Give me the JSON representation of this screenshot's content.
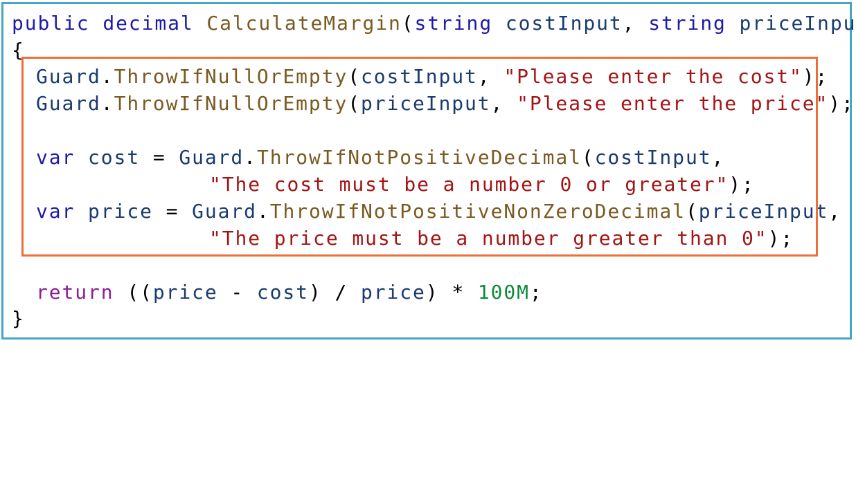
{
  "code": {
    "l1": {
      "kw1": "public",
      "kw2": "decimal",
      "method": "CalculateMargin",
      "p1": "(",
      "kw3": "string",
      "id1": "costInput",
      "p2": ",",
      "kw4": "string",
      "id2": "priceInput",
      "p3": ")"
    },
    "l2": {
      "brace": "{"
    },
    "l3": {
      "cls": "Guard",
      "dot": ".",
      "method": "ThrowIfNullOrEmpty",
      "p1": "(",
      "id": "costInput",
      "p2": ",",
      "str": "\"Please enter the cost\"",
      "p3": ");"
    },
    "l4": {
      "cls": "Guard",
      "dot": ".",
      "method": "ThrowIfNullOrEmpty",
      "p1": "(",
      "id": "priceInput",
      "p2": ",",
      "str": "\"Please enter the price\"",
      "p3": ");"
    },
    "l5": {
      "kw": "var",
      "id": "cost",
      "op": "=",
      "cls": "Guard",
      "dot": ".",
      "method": "ThrowIfNotPositiveDecimal",
      "p1": "(",
      "arg": "costInput",
      "p2": ","
    },
    "l6": {
      "str": "\"The cost must be a number 0 or greater\"",
      "p": ");"
    },
    "l7": {
      "kw": "var",
      "id": "price",
      "op": "=",
      "cls": "Guard",
      "dot": ".",
      "method": "ThrowIfNotPositiveNonZeroDecimal",
      "p1": "(",
      "arg": "priceInput",
      "p2": ","
    },
    "l8": {
      "str": "\"The price must be a number greater than 0\"",
      "p": ");"
    },
    "l9": {
      "kw": "return",
      "p1": "((",
      "id1": "price",
      "op1": "-",
      "id2": "cost",
      "p2": ")",
      "op2": "/",
      "id3": "price",
      "p3": ")",
      "op3": "*",
      "num": "100M",
      "p4": ";"
    },
    "l10": {
      "brace": "}"
    }
  },
  "colors": {
    "frame_border": "#46a6c4",
    "highlight_border": "#ee6e3a",
    "keyword": "#1f1aa6",
    "return_keyword": "#8b1e9a",
    "method": "#7a5a22",
    "identifier": "#1a3b6e",
    "string": "#a31515",
    "number": "#0b8a3a"
  }
}
